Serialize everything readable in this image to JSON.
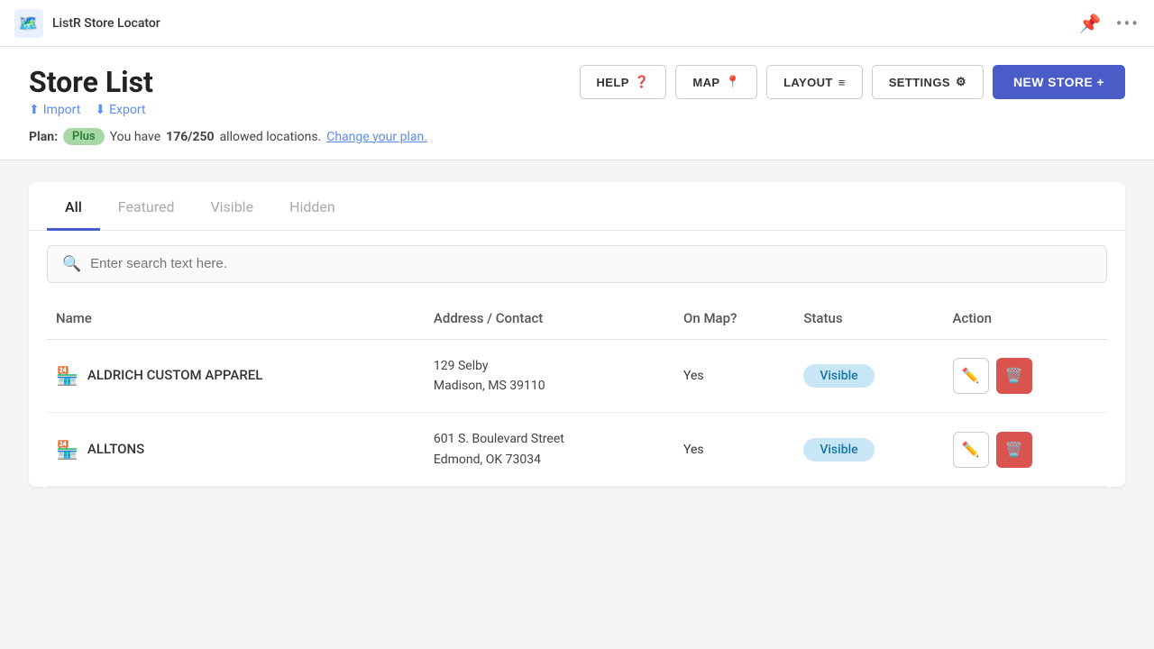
{
  "topbar": {
    "app_title": "ListR Store Locator",
    "pin_icon": "📌",
    "more_icon": "···"
  },
  "header": {
    "page_title": "Store List",
    "import_label": "Import",
    "export_label": "Export",
    "buttons": [
      {
        "id": "help",
        "label": "HELP",
        "icon": "❓"
      },
      {
        "id": "map",
        "label": "MAP",
        "icon": "📍"
      },
      {
        "id": "layout",
        "label": "LAYOUT",
        "icon": "≡"
      },
      {
        "id": "settings",
        "label": "SETTINGS",
        "icon": "⚙"
      }
    ],
    "new_store_label": "NEW STORE +",
    "plan_prefix": "Plan:",
    "plan_badge": "Plus",
    "plan_text_before": "You have",
    "plan_count": "176/250",
    "plan_text_after": "allowed locations.",
    "plan_link": "Change your plan."
  },
  "tabs": [
    {
      "id": "all",
      "label": "All",
      "active": true
    },
    {
      "id": "featured",
      "label": "Featured",
      "active": false
    },
    {
      "id": "visible",
      "label": "Visible",
      "active": false
    },
    {
      "id": "hidden",
      "label": "Hidden",
      "active": false
    }
  ],
  "search": {
    "placeholder": "Enter search text here."
  },
  "table": {
    "columns": [
      "Name",
      "Address / Contact",
      "On Map?",
      "Status",
      "Action"
    ],
    "rows": [
      {
        "name": "ALDRICH CUSTOM APPAREL",
        "address_line1": "129 Selby",
        "address_line2": "Madison, MS 39110",
        "on_map": "Yes",
        "status": "Visible"
      },
      {
        "name": "ALLTONS",
        "address_line1": "601 S. Boulevard Street",
        "address_line2": "Edmond, OK 73034",
        "on_map": "Yes",
        "status": "Visible"
      }
    ]
  }
}
